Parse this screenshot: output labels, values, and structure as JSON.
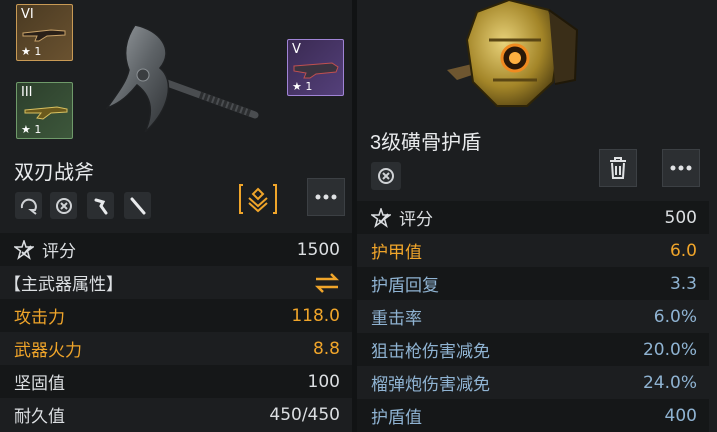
{
  "left": {
    "slots": [
      {
        "tier": "VI",
        "count": "1"
      },
      {
        "tier": "III",
        "count": "1"
      },
      {
        "tier": "V",
        "count": "1"
      }
    ],
    "title": "双刃战斧",
    "icons": [
      "shield-refresh-icon",
      "clock-x-icon",
      "hook-icon",
      "blade-icon"
    ],
    "stats": [
      {
        "label": "评分",
        "value": "1500",
        "color": "white",
        "icon": "score-icon"
      },
      {
        "label": "【主武器属性】",
        "value": "",
        "color": "white",
        "icon": "swap-icon"
      },
      {
        "label": "攻击力",
        "value": "118.0",
        "color": "orange"
      },
      {
        "label": "武器火力",
        "value": "8.8",
        "color": "orange"
      },
      {
        "label": "坚固值",
        "value": "100",
        "color": "white"
      },
      {
        "label": "耐久值",
        "value": "450/450",
        "color": "white"
      }
    ],
    "colors": {
      "accent": "#f0a52a",
      "text": "#dcdfe2"
    }
  },
  "right": {
    "title": "3级磺骨护盾",
    "stats": [
      {
        "label": "评分",
        "value": "500",
        "color": "white",
        "icon": "score-icon"
      },
      {
        "label": "护甲值",
        "value": "6.0",
        "color": "orange"
      },
      {
        "label": "护盾回复",
        "value": "3.3",
        "color": "blue"
      },
      {
        "label": "重击率",
        "value": "6.0%",
        "color": "blue"
      },
      {
        "label": "狙击枪伤害减免",
        "value": "20.0%",
        "color": "blue"
      },
      {
        "label": "榴弹炮伤害减免",
        "value": "24.0%",
        "color": "blue"
      },
      {
        "label": "护盾值",
        "value": "400",
        "color": "blue"
      }
    ],
    "colors": {
      "blue": "#8fb3d2",
      "orange": "#f0a52a"
    }
  }
}
